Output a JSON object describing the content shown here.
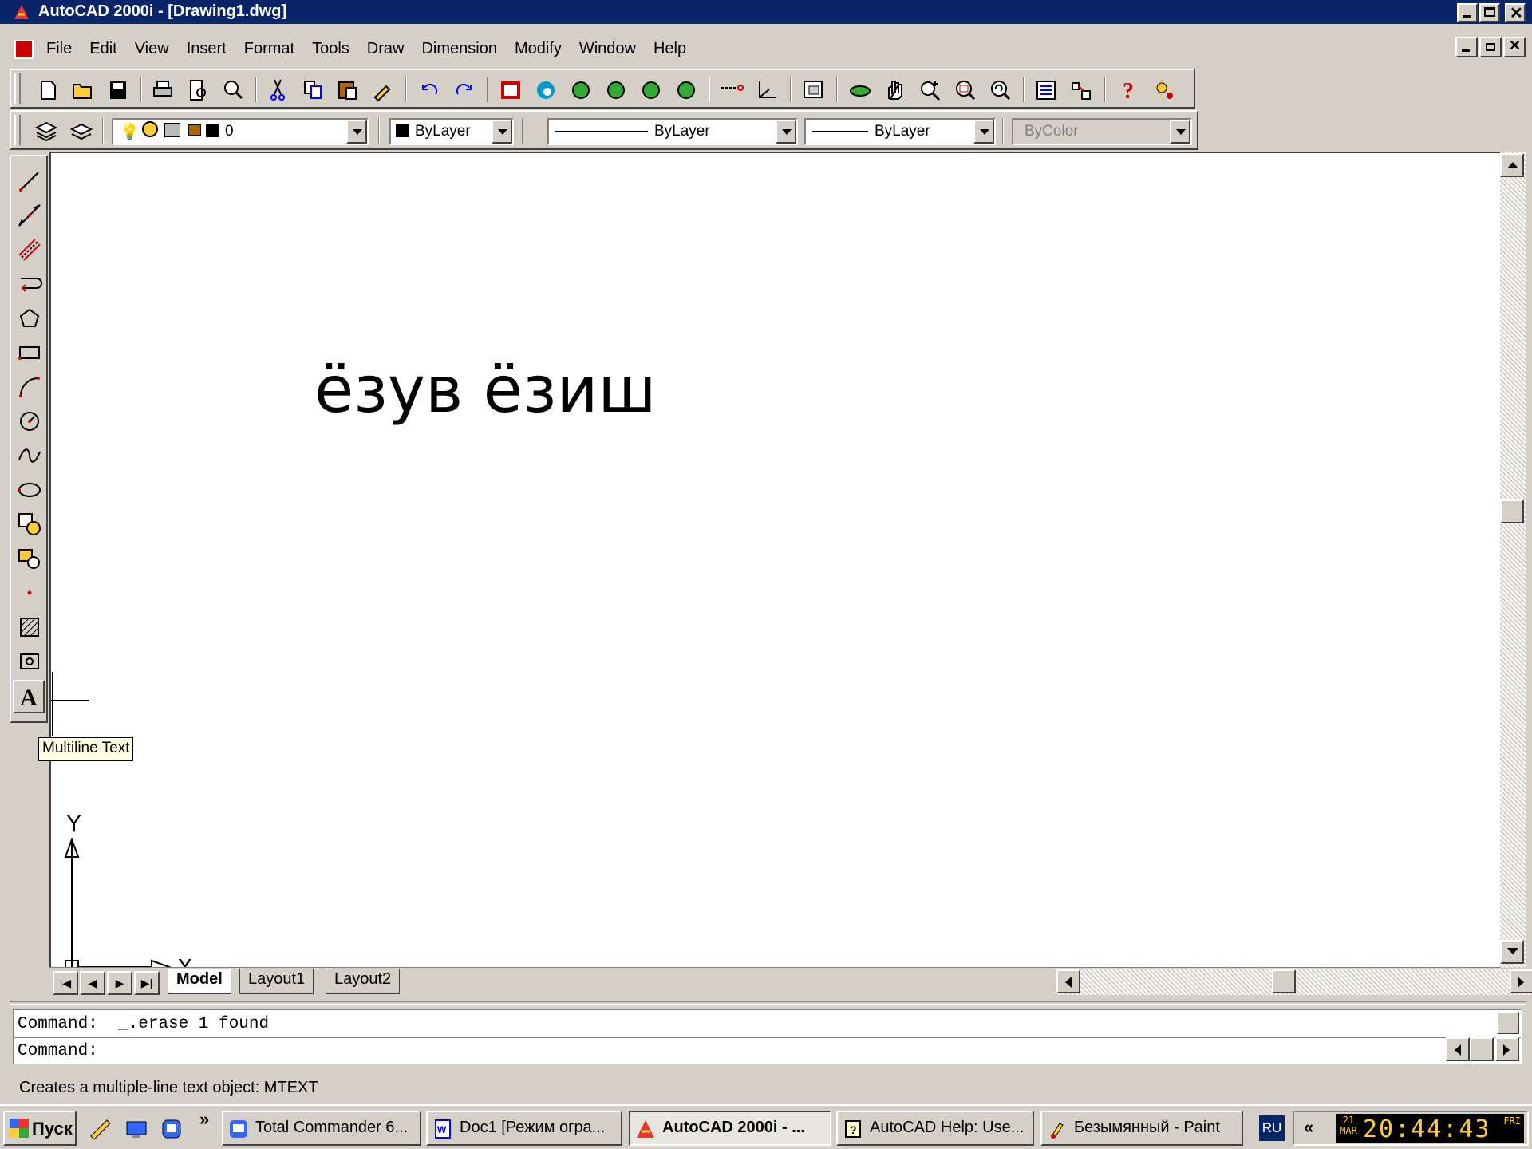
{
  "window": {
    "title": "AutoCAD 2000i - [Drawing1.dwg]"
  },
  "menu": [
    "File",
    "Edit",
    "View",
    "Insert",
    "Format",
    "Tools",
    "Draw",
    "Dimension",
    "Modify",
    "Window",
    "Help"
  ],
  "properties": {
    "layer": "0",
    "color": "ByLayer",
    "linetype": "ByLayer",
    "lineweight": "ByLayer",
    "plotstyle": "ByColor"
  },
  "drawing": {
    "text": "ёзув ёзиш"
  },
  "tooltip": "Multiline Text",
  "ucs": {
    "x_label": "X",
    "y_label": "Y"
  },
  "layout_tabs": [
    "Model",
    "Layout1",
    "Layout2"
  ],
  "command": {
    "line1": "Command:  _.erase 1 found",
    "line2": "Command:"
  },
  "status": "Creates a multiple-line text object:  MTEXT",
  "taskbar": {
    "start": "Пуск",
    "tasks": [
      "Total Commander 6...",
      "Doc1 [Режим огра...",
      "AutoCAD 2000i - ...",
      "AutoCAD Help: Use...",
      "Безымянный - Paint"
    ],
    "active_task": 2,
    "lang": "RU",
    "tray_arrow": "«",
    "date_day": "21",
    "date_month": "MAR",
    "time": "20:44:43",
    "weekday": "FRI"
  },
  "colors": {
    "titlebar": "#0a246a",
    "chrome": "#d4d0c8",
    "tooltip": "#ffffe1",
    "clock": "#ffcc33"
  }
}
